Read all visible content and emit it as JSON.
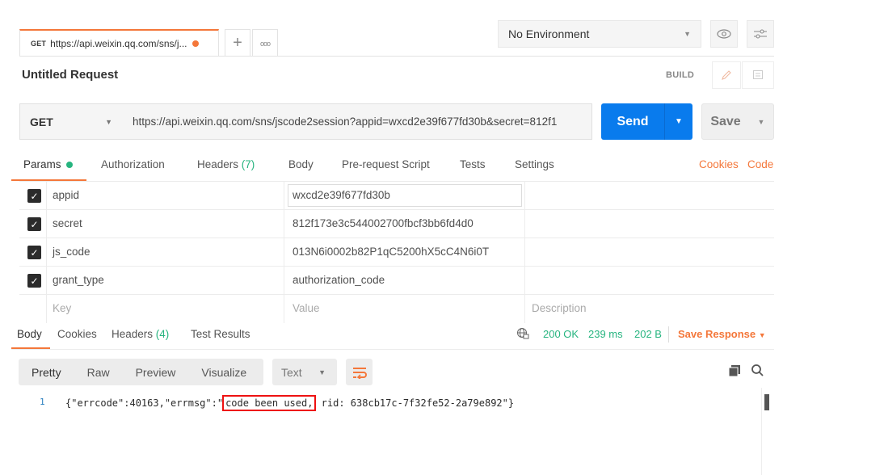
{
  "tab": {
    "method": "GET",
    "label": "https://api.weixin.qq.com/sns/j...",
    "add": "+",
    "more": "ooo"
  },
  "environment": {
    "label": "No Environment"
  },
  "request": {
    "title": "Untitled Request",
    "build": "BUILD",
    "method": "GET",
    "url": "https://api.weixin.qq.com/sns/jscode2session?appid=wxcd2e39f677fd30b&secret=812f1",
    "send": "Send",
    "save": "Save"
  },
  "request_tabs": [
    {
      "label": "Params"
    },
    {
      "label": "Authorization"
    },
    {
      "label": "Headers",
      "count": "(7)"
    },
    {
      "label": "Body"
    },
    {
      "label": "Pre-request Script"
    },
    {
      "label": "Tests"
    },
    {
      "label": "Settings"
    }
  ],
  "links": {
    "cookies": "Cookies",
    "code": "Code"
  },
  "params": [
    {
      "key": "appid",
      "value": "wxcd2e39f677fd30b",
      "checked": true
    },
    {
      "key": "secret",
      "value": "812f173e3c544002700fbcf3bb6fd4d0",
      "checked": true
    },
    {
      "key": "js_code",
      "value": "013N6i0002b82P1qC5200hX5cC4N6i0T",
      "checked": true
    },
    {
      "key": "grant_type",
      "value": "authorization_code",
      "checked": true
    }
  ],
  "params_placeholder": {
    "key": "Key",
    "value": "Value",
    "description": "Description"
  },
  "response_tabs": [
    {
      "label": "Body"
    },
    {
      "label": "Cookies"
    },
    {
      "label": "Headers",
      "count": "(4)"
    },
    {
      "label": "Test Results"
    }
  ],
  "response_status": {
    "code": "200 OK",
    "time": "239 ms",
    "size": "202 B",
    "save": "Save Response"
  },
  "view_modes": [
    "Pretty",
    "Raw",
    "Preview",
    "Visualize"
  ],
  "format": "Text",
  "body": {
    "line_number": "1",
    "pre": "{\"errcode\":40163,\"errmsg\":\"",
    "highlight": "code been used,",
    "post": " rid: 638cb17c-7f32fe52-2a79e892\"}"
  },
  "colors": {
    "accent": "#f4773a",
    "send": "#097bed",
    "ok": "#26b47f",
    "highlight": "#ee1111"
  }
}
